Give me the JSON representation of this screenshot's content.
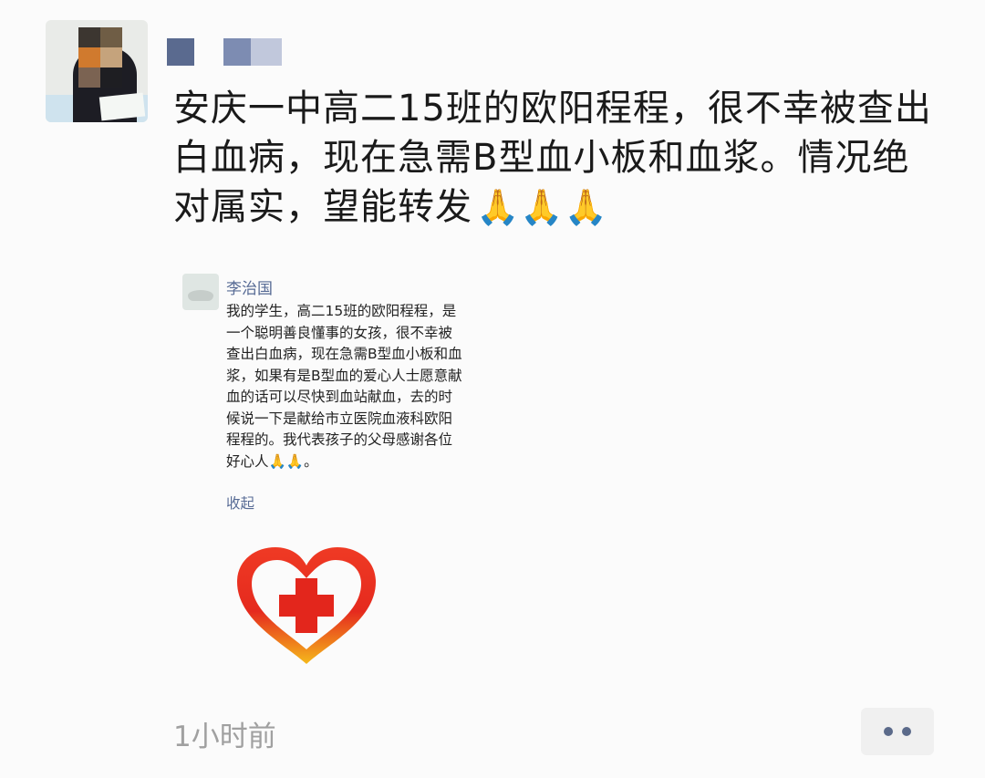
{
  "post": {
    "text": "安庆一中高二15班的欧阳程程，很不幸被查出白血病，现在急需B型血小板和血浆。情况绝对属实，望能转发",
    "trailing_emoji": "🙏🙏🙏",
    "time": "1小时前"
  },
  "shared": {
    "author": "李治国",
    "body": "我的学生，高二15班的欧阳程程，是一个聪明善良懂事的女孩，很不幸被查出白血病，现在急需B型血小板和血浆，如果有是B型血的爱心人士愿意献血的话可以尽快到血站献血，去的时候说一下是献给市立医院血液科欧阳程程的。我代表孩子的父母感谢各位好心人🙏🙏。",
    "collapse_label": "收起"
  },
  "icons": {
    "more": "more-dots-icon",
    "logo": "red-cross-heart-icon",
    "hands": "praying-hands-icon"
  },
  "colors": {
    "link": "#576b95",
    "heart_red": "#e02a20",
    "heart_yellow": "#f6c21a"
  }
}
